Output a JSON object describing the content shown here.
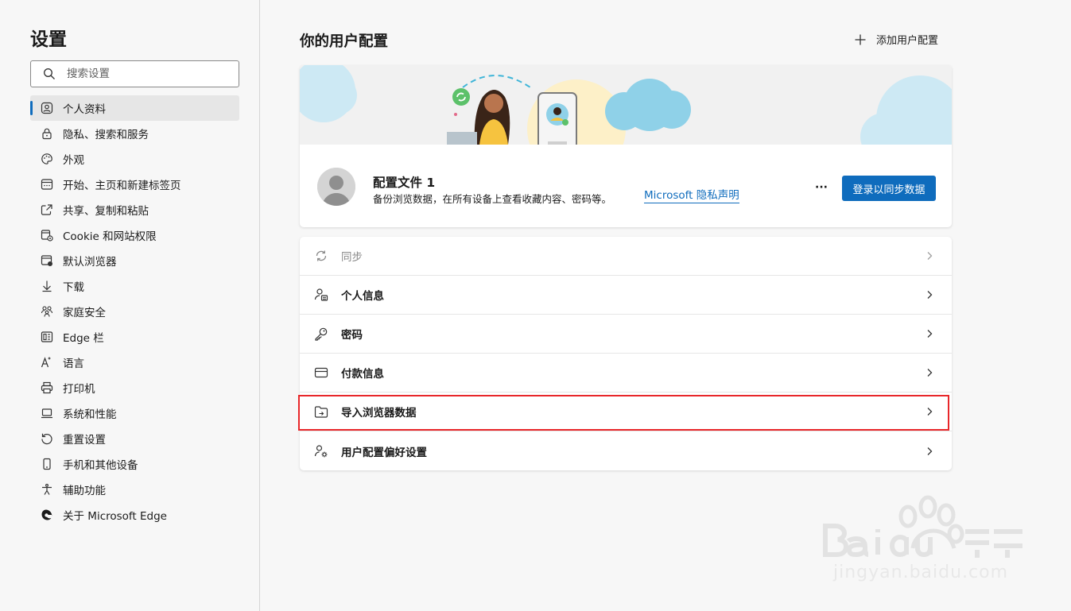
{
  "sidebar": {
    "title": "设置",
    "search_placeholder": "搜索设置",
    "items": [
      {
        "label": "个人资料",
        "icon": "profile-icon",
        "active": true
      },
      {
        "label": "隐私、搜索和服务",
        "icon": "lock-icon"
      },
      {
        "label": "外观",
        "icon": "appearance-icon"
      },
      {
        "label": "开始、主页和新建标签页",
        "icon": "home-tab-icon"
      },
      {
        "label": "共享、复制和粘贴",
        "icon": "share-icon"
      },
      {
        "label": "Cookie 和网站权限",
        "icon": "cookie-icon"
      },
      {
        "label": "默认浏览器",
        "icon": "default-browser-icon"
      },
      {
        "label": "下载",
        "icon": "download-icon"
      },
      {
        "label": "家庭安全",
        "icon": "family-icon"
      },
      {
        "label": "Edge 栏",
        "icon": "edge-bar-icon"
      },
      {
        "label": "语言",
        "icon": "language-icon"
      },
      {
        "label": "打印机",
        "icon": "printer-icon"
      },
      {
        "label": "系统和性能",
        "icon": "laptop-icon"
      },
      {
        "label": "重置设置",
        "icon": "reset-icon"
      },
      {
        "label": "手机和其他设备",
        "icon": "phone-icon"
      },
      {
        "label": "辅助功能",
        "icon": "accessibility-icon"
      },
      {
        "label": "关于 Microsoft Edge",
        "icon": "edge-logo-icon"
      }
    ]
  },
  "main": {
    "title": "你的用户配置",
    "add_profile_label": "添加用户配置",
    "profile": {
      "name": "配置文件 1",
      "description": "备份浏览数据，在所有设备上查看收藏内容、密码等。",
      "privacy_link": "Microsoft 隐私声明",
      "more_label": "···",
      "signin_label": "登录以同步数据"
    },
    "rows": [
      {
        "label": "同步",
        "icon": "sync-icon",
        "disabled": true
      },
      {
        "label": "个人信息",
        "icon": "personal-info-icon"
      },
      {
        "label": "密码",
        "icon": "key-icon"
      },
      {
        "label": "付款信息",
        "icon": "card-icon"
      },
      {
        "label": "导入浏览器数据",
        "icon": "import-icon",
        "highlighted": true
      },
      {
        "label": "用户配置偏好设置",
        "icon": "profile-prefs-icon"
      }
    ]
  },
  "colors": {
    "accent": "#0f6cbd",
    "highlight": "#e8272a"
  },
  "watermark": {
    "text": "jingyan.baidu.com"
  }
}
